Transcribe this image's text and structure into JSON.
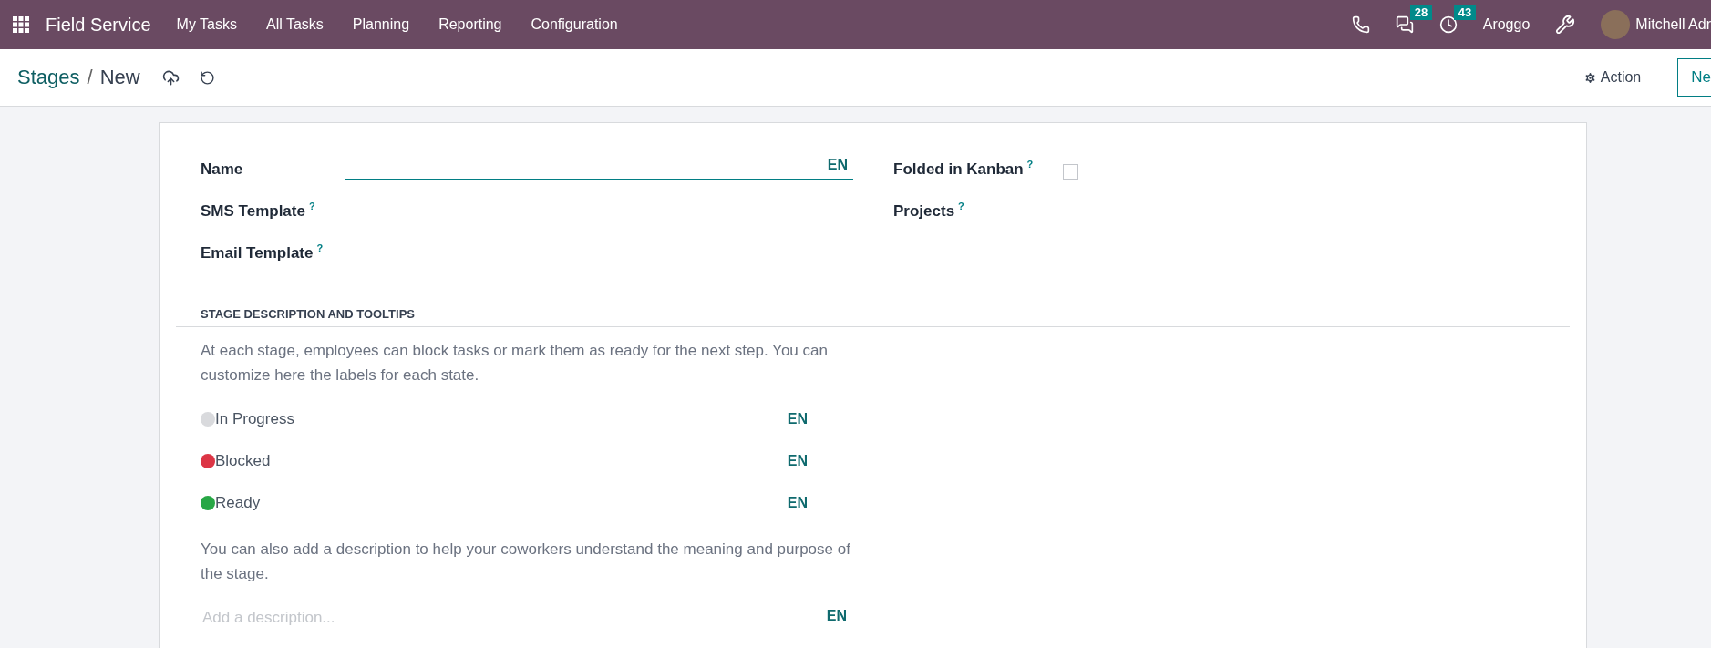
{
  "navbar": {
    "app_name": "Field Service",
    "menu": [
      "My Tasks",
      "All Tasks",
      "Planning",
      "Reporting",
      "Configuration"
    ],
    "systray": [
      {
        "kind": "phone"
      },
      {
        "kind": "chat",
        "count": "28"
      },
      {
        "kind": "activity",
        "count": "43"
      },
      {
        "kind": "company",
        "label": "Aroggo"
      },
      {
        "kind": "tools"
      },
      {
        "kind": "user",
        "label": "Mitchell Adr"
      }
    ]
  },
  "control_panel": {
    "breadcrumb": {
      "parent": "Stages",
      "separator": "/",
      "current": "New"
    },
    "action": "Action",
    "new_button": "Ne"
  },
  "form": {
    "left_fields": [
      {
        "label": "Name",
        "kind": "text",
        "lang": "EN"
      },
      {
        "label": "SMS Template",
        "help": "?",
        "kind": "many2one"
      },
      {
        "label": "Email Template",
        "help": "?",
        "kind": "many2one"
      }
    ],
    "right_fields": [
      {
        "label": "Folded in Kanban",
        "help": "?",
        "kind": "checkbox",
        "checked": false
      },
      {
        "label": "Projects",
        "help": "?",
        "kind": "many2many"
      }
    ],
    "section": {
      "title": "STAGE DESCRIPTION AND TOOLTIPS",
      "intro": "At each stage, employees can block tasks or mark them as ready for the next step. You can customize here the labels for each state.",
      "states": [
        {
          "label": "In Progress",
          "color": "#d9dadd",
          "lang": "EN"
        },
        {
          "label": "Blocked",
          "color": "#dc3545",
          "lang": "EN"
        },
        {
          "label": "Ready",
          "color": "#28a745",
          "lang": "EN"
        }
      ],
      "description_hint": "You can also add a description to help your coworkers understand the meaning and purpose of the stage.",
      "description": {
        "placeholder": "Add a description...",
        "lang": "EN"
      }
    }
  }
}
